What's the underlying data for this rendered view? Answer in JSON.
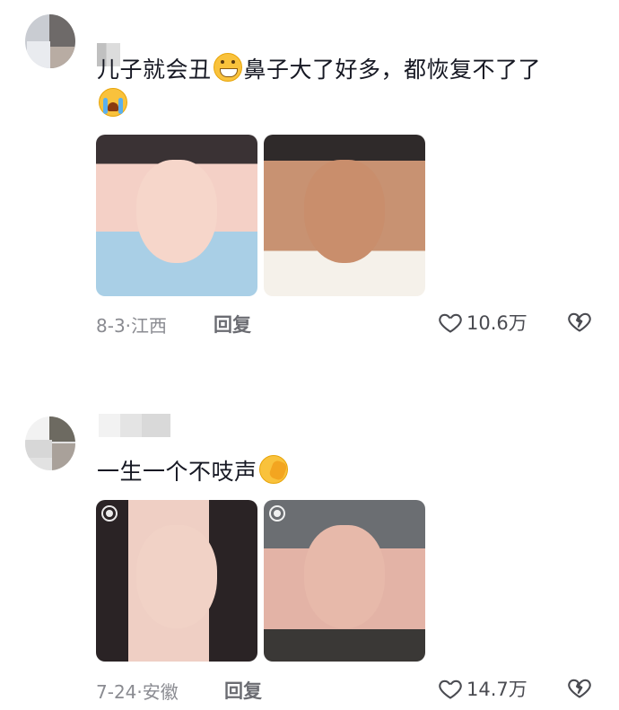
{
  "comments": [
    {
      "text_before": "儿子就会丑",
      "text_after": "鼻子大了好多，都恢复不了了",
      "date": "8-3",
      "location": "江西",
      "reply_label": "回复",
      "likes": "10.6万"
    },
    {
      "text": "一生一个不吱声",
      "date": "7-24",
      "location": "安徽",
      "reply_label": "回复",
      "likes": "14.7万"
    }
  ],
  "icons": {
    "heart": "heart-outline-icon",
    "dislike": "broken-heart-icon",
    "live_photo": "live-photo-icon"
  },
  "colors": {
    "text": "#161823",
    "meta": "#8a8b91",
    "emoji": "#f9c23c"
  }
}
